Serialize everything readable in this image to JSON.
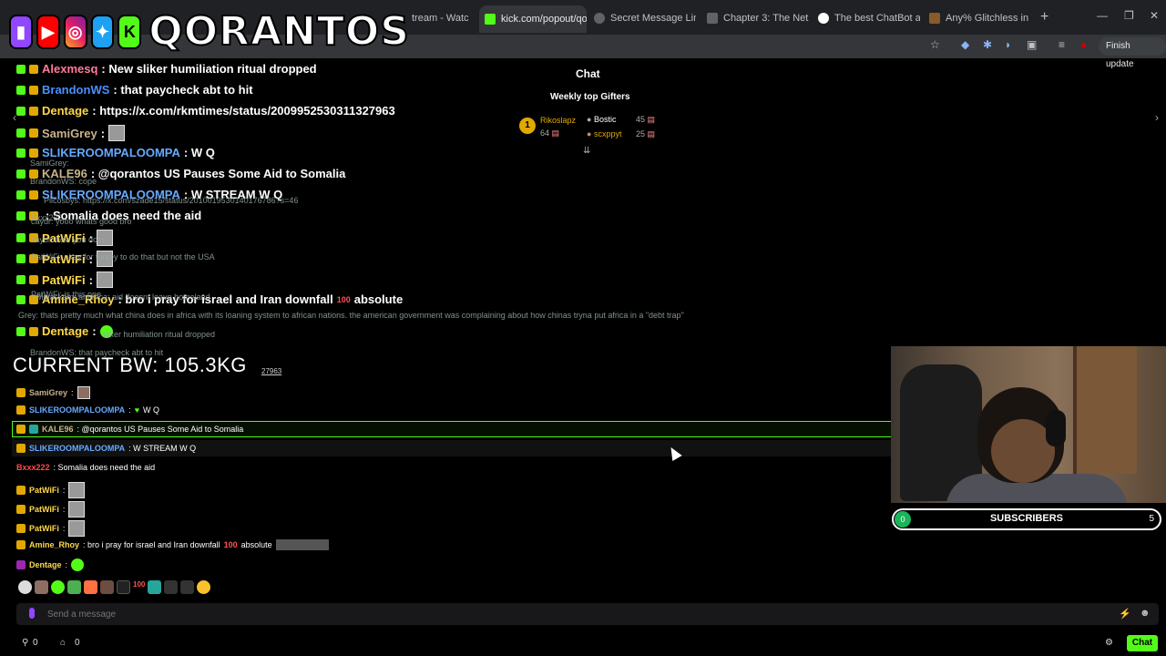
{
  "browser": {
    "tabs": [
      {
        "label": "tream - Watc",
        "color": "#9146ff",
        "active": false
      },
      {
        "label": "kick.com/popout/qo",
        "color": "#53fc18",
        "active": true
      },
      {
        "label": "Secret Message Link",
        "color": "#5f6368",
        "active": false
      },
      {
        "label": "Chapter 3: The Neth",
        "color": "#5f6368",
        "active": false
      },
      {
        "label": "The best ChatBot an",
        "color": "#ffffff",
        "active": false
      },
      {
        "label": "Any% Glitchless in 1:",
        "color": "#8b5a2b",
        "active": false
      }
    ],
    "new_tab": "+",
    "finish_update": "Finish update"
  },
  "logo": {
    "icons": [
      "twitch",
      "youtube",
      "instagram",
      "twitter",
      "kick"
    ],
    "text": "QORANTOS"
  },
  "popout": {
    "chat_header": "Chat",
    "gifters_title": "Weekly top Gifters",
    "gifters": [
      {
        "rank": "1",
        "name": "Rikoslapz",
        "count": "64"
      },
      {
        "name": "Bostic",
        "count": "45"
      },
      {
        "name": "scxppyt",
        "count": "25"
      }
    ]
  },
  "overlay_chat": [
    {
      "user": "Alexmesq",
      "color": "#ff7b9c",
      "text": ": New sliker humiliation ritual dropped"
    },
    {
      "user": "BrandonWS",
      "color": "#4a90ff",
      "text": ": that paycheck abt to hit"
    },
    {
      "user": "Dentage",
      "color": "#ffd84a",
      "text": ": https://x.com/rkmtimes/status/2009952530311327963"
    },
    {
      "user": "SamiGrey",
      "color": "#c9b28a",
      "text": ":"
    },
    {
      "user": "SLIKEROOMPALOOMPA",
      "color": "#66aaff",
      "text": ": W Q"
    },
    {
      "user": "KALE96",
      "color": "#c9b28a",
      "text": ": @qorantos US Pauses Some Aid to Somalia"
    },
    {
      "user": "SLIKEROOMPALOOMPA",
      "color": "#66aaff",
      "text": ": W STREAM W Q"
    },
    {
      "user": "",
      "color": "#ff4a4a",
      "text": ": Somalia does need the aid"
    },
    {
      "user": "PatWiFi",
      "color": "#ffd84a",
      "text": ":"
    },
    {
      "user": "PatWiFi",
      "color": "#ffd84a",
      "text": ":"
    },
    {
      "user": "PatWiFi",
      "color": "#ffd84a",
      "text": ":"
    },
    {
      "user": "Amine_Rhoy",
      "color": "#ffd84a",
      "text": ": bro i pray for israel and Iran downfall"
    },
    {
      "user": "Dentage",
      "color": "#ffd84a",
      "text": ":"
    }
  ],
  "overlay_extra": {
    "emoji_100": "100",
    "absolute": "absolute"
  },
  "ghost_lines": [
    "SamiGrey:",
    "BrandonWS: cope",
    "Pilcosbys: https://x.com/szade15/status/2010019530140176786?s=46",
    "Bxxx222",
    "caydr: yooo whats good bro",
    "caydr: how you doin",
    "PatWiFi: okay for turkey to do that but not the USA",
    "PatWiFi: is this one",
    "Mjuaskem: america: aid doesnt leave homeland",
    "Grey: thats pretty much what china does in africa with its loaning system to african nations. the american government was complaining about how chinas tryna put africa in a \"debt trap\"",
    "sliker humiliation ritual dropped",
    "BrandonWS: that paycheck abt to hit"
  ],
  "bodyweight": "CURRENT BW: 105.3KG",
  "bodyweight_ghost": "27963",
  "chat": [
    {
      "user": "SamiGrey",
      "color": "#c9b28a",
      "text": ":"
    },
    {
      "user": "SLIKEROOMPALOOMPA",
      "color": "#66aaff",
      "text": ":"
    },
    {
      "user": "KALE96",
      "color": "#c9b28a",
      "text": ": @qorantos US Pauses Some Aid to Somalia"
    },
    {
      "user": "SLIKEROOMPALOOMPA",
      "color": "#66aaff",
      "text": ": W STREAM W Q"
    },
    {
      "user": "Bxxx222",
      "color": "#ff4a4a",
      "text": ": Somalia does need the aid"
    },
    {
      "user": "PatWiFi",
      "color": "#ffd84a",
      "text": ":"
    },
    {
      "user": "PatWiFi",
      "color": "#ffd84a",
      "text": ":"
    },
    {
      "user": "PatWiFi",
      "color": "#ffd84a",
      "text": ":"
    },
    {
      "user": "Amine_Rhoy",
      "color": "#ffd84a",
      "text": ": bro i pray for israel and Iran downfall"
    },
    {
      "user": "Dentage",
      "color": "#ffd84a",
      "text": ":"
    }
  ],
  "chat_extra": {
    "wq": "W Q",
    "emoji_100": "100",
    "absolute": "absolute"
  },
  "input": {
    "placeholder": "Send a message"
  },
  "bottom": {
    "viewers": "0",
    "gifts": "0",
    "chat_button": "Chat"
  },
  "subscribers": {
    "start": "0",
    "label": "SUBSCRIBERS",
    "goal": "5",
    "progress": 0
  }
}
